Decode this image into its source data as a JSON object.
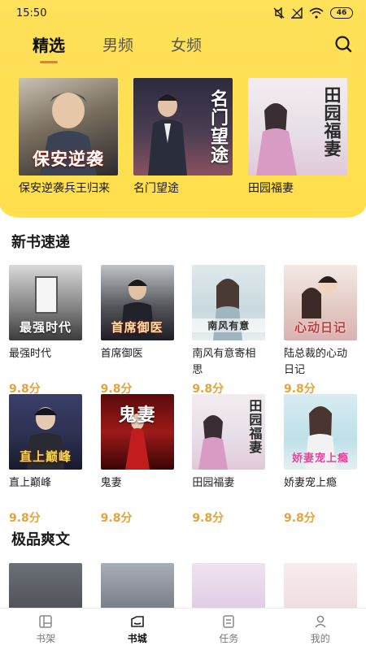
{
  "status": {
    "time": "15:50",
    "battery": "46"
  },
  "tabs": [
    {
      "label": "精选"
    },
    {
      "label": "男频"
    },
    {
      "label": "女频"
    }
  ],
  "featured": [
    {
      "title": "保安逆袭兵王归来",
      "cover_text": "保安逆袭"
    },
    {
      "title": "名门望途",
      "cover_text": "名门望途"
    },
    {
      "title": "田园福妻",
      "cover_text": "田园福妻"
    }
  ],
  "sections": [
    {
      "title": "新书速递",
      "rows": [
        [
          {
            "title": "最强时代",
            "score": "9.8分",
            "cover_text": "最强时代"
          },
          {
            "title": "首席御医",
            "score": "9.8分",
            "cover_text": "首席御医"
          },
          {
            "title": "南风有意寄相思",
            "score": "9.8分",
            "cover_text": "南风有意"
          },
          {
            "title": "陆总裁的心动日记",
            "score": "9.8分",
            "cover_text": "心动日记"
          }
        ],
        [
          {
            "title": "直上巅峰",
            "score": "9.8分",
            "cover_text": "直上巅峰"
          },
          {
            "title": "鬼妻",
            "score": "9.8分",
            "cover_text": "鬼妻"
          },
          {
            "title": "田园福妻",
            "score": "9.8分",
            "cover_text": "田园福妻"
          },
          {
            "title": "娇妻宠上瘾",
            "score": "9.8分",
            "cover_text": "娇妻宠上瘾"
          }
        ]
      ]
    },
    {
      "title": "极品爽文"
    }
  ],
  "bottom_nav": [
    {
      "label": "书架",
      "icon": "bookshelf-icon"
    },
    {
      "label": "书城",
      "icon": "bookstore-icon"
    },
    {
      "label": "任务",
      "icon": "task-icon"
    },
    {
      "label": "我的",
      "icon": "profile-icon"
    }
  ],
  "colors": {
    "header_yellow": "#ffdf4c",
    "tab_underline": "#e9793a",
    "score": "#e8a23a"
  }
}
